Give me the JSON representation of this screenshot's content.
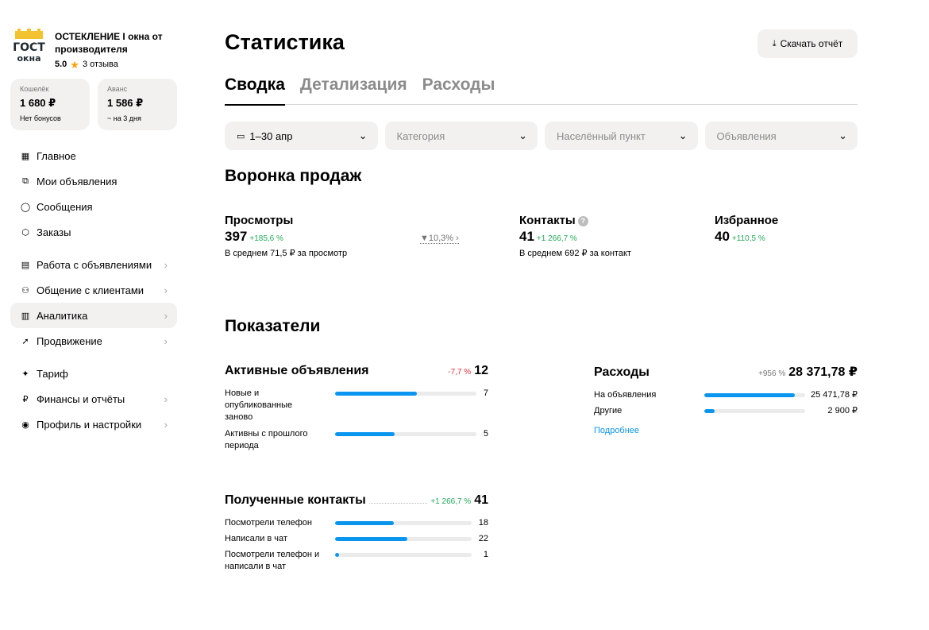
{
  "profile": {
    "name": "ОСТЕКЛЕНИЕ I окна от производителя",
    "rating": "5.0",
    "reviews": "3 отзыва",
    "logo_text_top": "ГОСТ",
    "logo_text_bottom": "окна"
  },
  "wallets": [
    {
      "label": "Кошелёк",
      "value": "1 680 ₽",
      "sub": "Нет бонусов"
    },
    {
      "label": "Аванс",
      "value": "1 586 ₽",
      "sub": "~ на 3 дня"
    }
  ],
  "nav": {
    "home": {
      "label": "Главное",
      "icon": "grid-icon"
    },
    "ads": {
      "label": "Мои объявления",
      "icon": "copy-icon"
    },
    "messages": {
      "label": "Сообщения",
      "icon": "chat-icon"
    },
    "orders": {
      "label": "Заказы",
      "icon": "box-icon"
    },
    "work": {
      "label": "Работа с объявлениями",
      "icon": "edit-doc-icon"
    },
    "clients": {
      "label": "Общение с клиентами",
      "icon": "users-icon"
    },
    "analytics": {
      "label": "Аналитика",
      "icon": "bar-chart-icon"
    },
    "promo": {
      "label": "Продвижение",
      "icon": "rocket-icon"
    },
    "tariff": {
      "label": "Тариф",
      "icon": "sparkle-icon"
    },
    "finance": {
      "label": "Финансы и отчёты",
      "icon": "ruble-icon"
    },
    "profile": {
      "label": "Профиль и настройки",
      "icon": "person-icon"
    }
  },
  "page": {
    "title": "Статистика",
    "download_label": "Скачать отчёт"
  },
  "tabs": [
    "Сводка",
    "Детализация",
    "Расходы"
  ],
  "filters": {
    "date": "1–30 апр",
    "category": "Категория",
    "city": "Населённый пункт",
    "ads": "Объявления"
  },
  "funnel": {
    "title": "Воронка продаж",
    "views": {
      "label": "Просмотры",
      "value": "397",
      "delta": "+185,6 %",
      "sub": "В среднем 71,5 ₽ за просмотр"
    },
    "conversion": "10,3%",
    "contacts": {
      "label": "Контакты",
      "value": "41",
      "delta": "+1 266,7 %",
      "sub": "В среднем 692 ₽ за контакт"
    },
    "favorites": {
      "label": "Избранное",
      "value": "40",
      "delta": "+110,5 %"
    }
  },
  "metrics": {
    "title": "Показатели",
    "active": {
      "label": "Активные объявления",
      "delta": "-7,7 %",
      "value": "12",
      "rows": [
        {
          "label": "Новые и опубликованные заново",
          "value": "7",
          "fill": 0.58
        },
        {
          "label": "Активны с прошлого периода",
          "value": "5",
          "fill": 0.42
        }
      ]
    },
    "expenses": {
      "label": "Расходы",
      "delta": "+956 %",
      "value": "28 371,78 ₽",
      "rows": [
        {
          "label": "На объявления",
          "value": "25 471,78 ₽",
          "fill": 0.9
        },
        {
          "label": "Другие",
          "value": "2 900 ₽",
          "fill": 0.1
        }
      ],
      "link": "Подробнее"
    },
    "contacts": {
      "label": "Полученные контакты",
      "delta": "+1 266,7 %",
      "value": "41",
      "rows": [
        {
          "label": "Посмотрели телефон",
          "value": "18",
          "fill": 0.43
        },
        {
          "label": "Написали в чат",
          "value": "22",
          "fill": 0.53
        },
        {
          "label": "Посмотрели телефон и написали в чат",
          "value": "1",
          "fill": 0.03
        }
      ]
    }
  }
}
